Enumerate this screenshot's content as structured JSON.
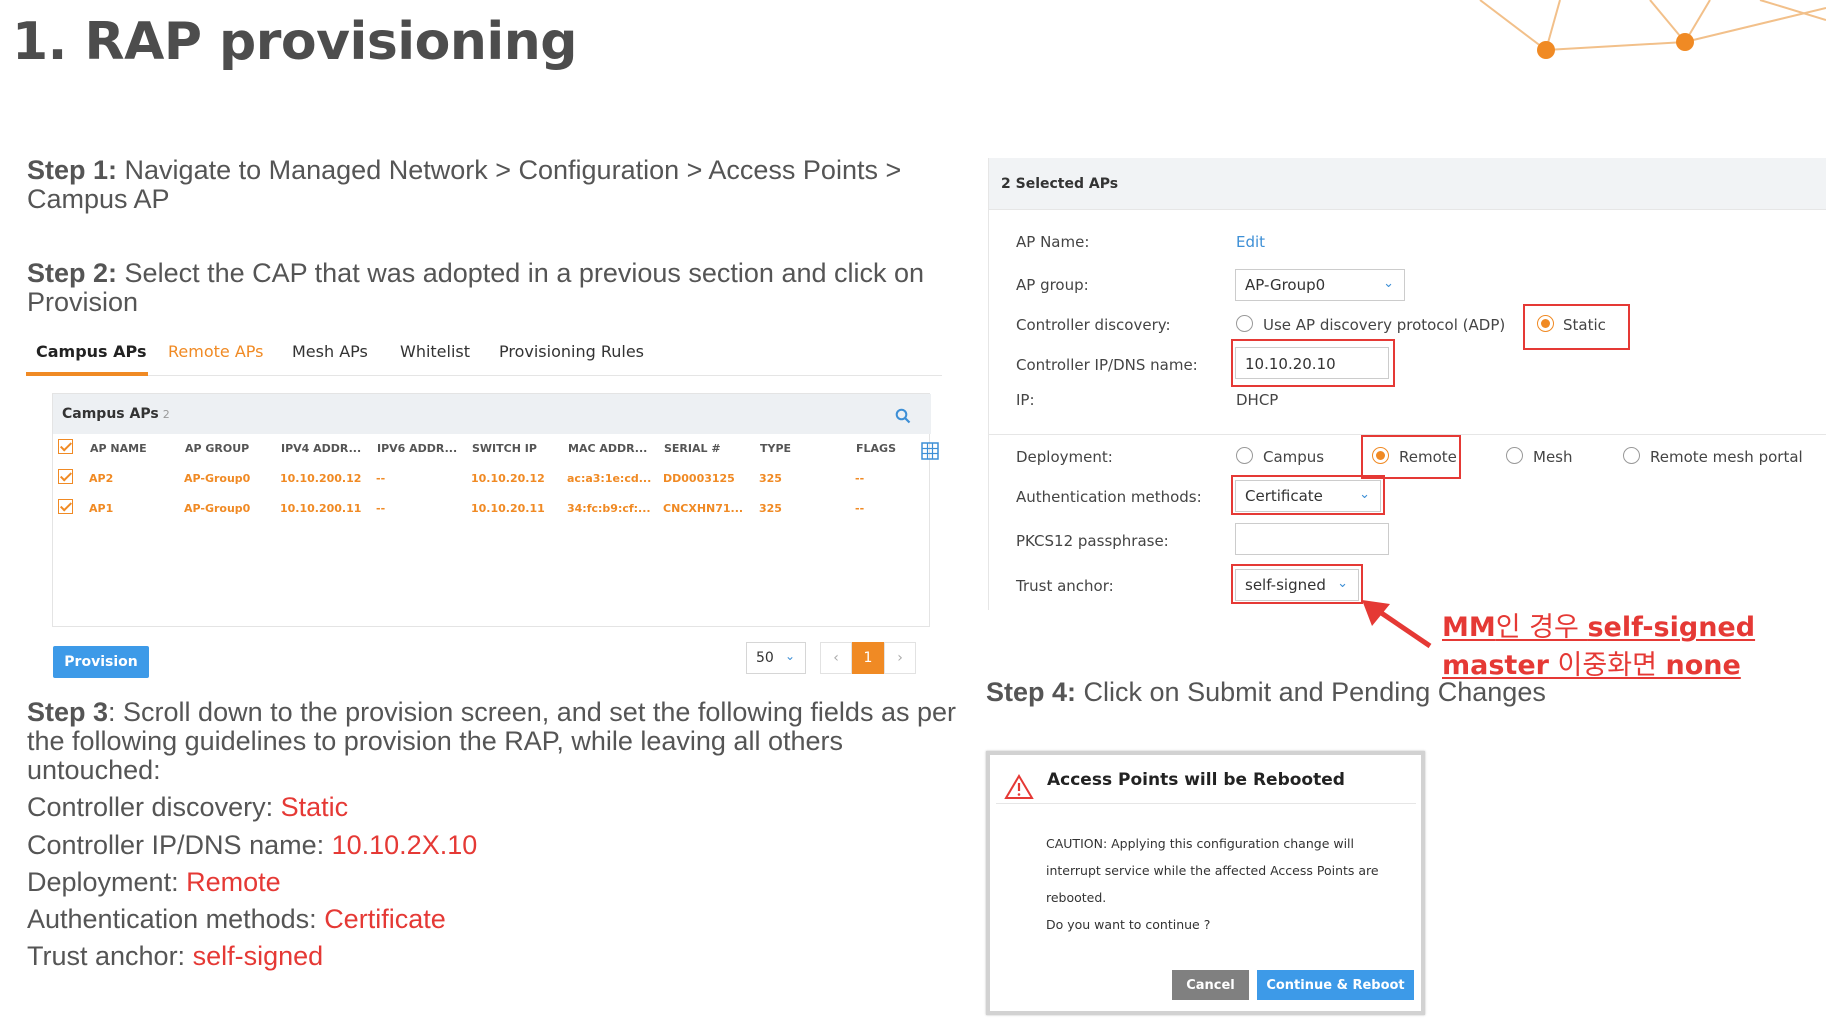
{
  "slide": {
    "title": "1. RAP provisioning"
  },
  "steps": {
    "step1_label": "Step 1:",
    "step1_line1": "Navigate to Managed Network > Configuration > Access Points >",
    "step1_line2": "Campus AP",
    "step2_label": "Step 2:",
    "step2_line1": "Select the CAP that was adopted in a previous section and click on",
    "step2_line2": "Provision",
    "step3_label": "Step 3",
    "step3_line1": ": Scroll down to the provision screen, and set the following fields as per",
    "step3_line2": "the following guidelines to provision the RAP, while leaving all others",
    "step3_line3": "untouched:",
    "step4_label": "Step 4:",
    "step4_text": "Click on Submit and Pending Changes"
  },
  "guidelines": [
    {
      "key": "Controller discovery: ",
      "value": "Static"
    },
    {
      "key": "Controller IP/DNS name: ",
      "value": "10.10.2X.10"
    },
    {
      "key": "Deployment: ",
      "value": "Remote"
    },
    {
      "key": "Authentication methods: ",
      "value": "Certificate"
    },
    {
      "key": "Trust anchor: ",
      "value": "self-signed"
    }
  ],
  "tabs": [
    "Campus APs",
    "Remote APs",
    "Mesh APs",
    "Whitelist",
    "Provisioning Rules"
  ],
  "ap_table": {
    "title": "Campus APs",
    "count": "2",
    "columns": [
      "AP NAME",
      "AP GROUP",
      "IPV4 ADDR...",
      "IPV6 ADDR...",
      "SWITCH IP",
      "MAC ADDR...",
      "SERIAL #",
      "TYPE",
      "FLAGS"
    ],
    "rows": [
      [
        "AP2",
        "AP-Group0",
        "10.10.200.12",
        "--",
        "10.10.20.12",
        "ac:a3:1e:cd...",
        "DD0003125",
        "325",
        "--"
      ],
      [
        "AP1",
        "AP-Group0",
        "10.10.200.11",
        "--",
        "10.10.20.11",
        "34:fc:b9:cf:...",
        "CNCXHN71...",
        "325",
        "--"
      ]
    ],
    "provision_label": "Provision",
    "page_size": "50",
    "prev": "‹",
    "page": "1",
    "next": "›"
  },
  "form": {
    "header": "2 Selected APs",
    "ap_name_label": "AP Name:",
    "ap_name_value": "Edit",
    "ap_group_label": "AP group:",
    "ap_group_value": "AP-Group0",
    "discovery_label": "Controller discovery:",
    "discovery_adp": "Use AP discovery protocol (ADP)",
    "discovery_static": "Static",
    "ctrl_ip_label": "Controller IP/DNS name:",
    "ctrl_ip_value": "10.10.20.10",
    "ip_label": "IP:",
    "ip_value": "DHCP",
    "deployment_label": "Deployment:",
    "deploy_campus": "Campus",
    "deploy_remote": "Remote",
    "deploy_mesh": "Mesh",
    "deploy_remote_mesh": "Remote mesh portal",
    "auth_label": "Authentication methods:",
    "auth_value": "Certificate",
    "pkcs_label": "PKCS12 passphrase:",
    "pkcs_value": "",
    "trust_label": "Trust anchor:",
    "trust_value": "self-signed"
  },
  "annotation": {
    "line1_a": "MM",
    "line1_b": "인 경우 ",
    "line1_c": "self-signed",
    "line2_a": "master",
    "line2_b": " 이중화면 ",
    "line2_c": "none"
  },
  "dialog": {
    "title": "Access Points will be Rebooted",
    "body1": "CAUTION: Applying this configuration change will",
    "body2": "interrupt service while the affected Access Points are",
    "body3": "rebooted.",
    "body4": "Do you want to continue ?",
    "cancel": "Cancel",
    "continue": "Continue & Reboot"
  },
  "colors": {
    "accent_orange": "#f08a24",
    "annotation_red": "#e53935",
    "button_blue": "#3d9ae8"
  }
}
